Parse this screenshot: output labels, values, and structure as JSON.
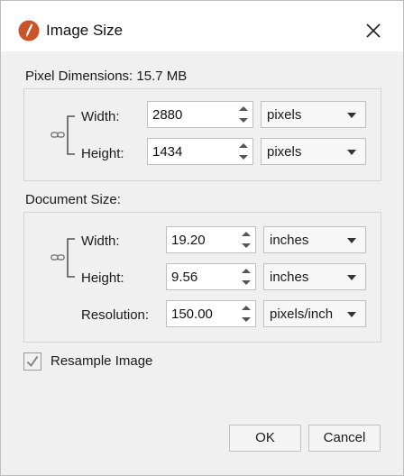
{
  "window": {
    "title": "Image Size",
    "icons": {
      "app": "brush-pen-icon",
      "close": "close-icon"
    }
  },
  "pixel_dimensions": {
    "label": "Pixel Dimensions:",
    "size": "15.7 MB",
    "width": {
      "label": "Width:",
      "value": "2880",
      "unit": "pixels"
    },
    "height": {
      "label": "Height:",
      "value": "1434",
      "unit": "pixels"
    }
  },
  "document_size": {
    "label": "Document Size:",
    "width": {
      "label": "Width:",
      "value": "19.20",
      "unit": "inches"
    },
    "height": {
      "label": "Height:",
      "value": "9.56",
      "unit": "inches"
    },
    "resolution": {
      "label": "Resolution:",
      "value": "150.00",
      "unit": "pixels/inch"
    }
  },
  "resample": {
    "label": "Resample Image",
    "checked": true
  },
  "buttons": {
    "ok": "OK",
    "cancel": "Cancel"
  },
  "colors": {
    "dialog_bg": "#f0f0f0",
    "titlebar_bg": "#ffffff",
    "icon_accent": "#c8542a"
  }
}
